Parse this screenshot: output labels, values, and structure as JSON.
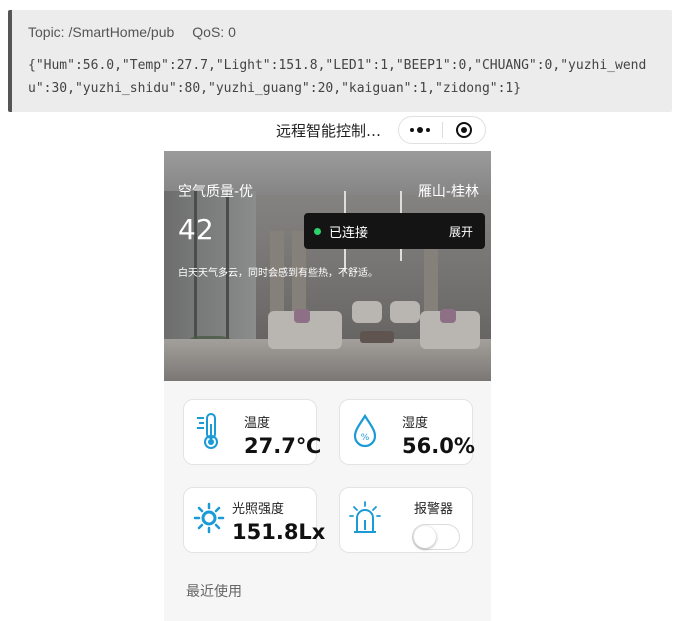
{
  "mqtt": {
    "topic": "Topic: /SmartHome/pub",
    "qos": "QoS: 0",
    "payload": "{\"Hum\":56.0,\"Temp\":27.7,\"Light\":151.8,\"LED1\":1,\"BEEP1\":0,\"CHUANG\":0,\"yuzhi_wendu\":30,\"yuzhi_shidu\":80,\"yuzhi_guang\":20,\"kaiguan\":1,\"zidong\":1}"
  },
  "miniprogram": {
    "title": "远程智能控制…",
    "menu_icon": "more-dots-icon",
    "close_icon": "target-circle-icon"
  },
  "hero": {
    "air_quality": "空气质量-优",
    "location": "雁山-桂林",
    "aqi": "42",
    "weather_desc": "白天天气多云，同时会感到有些热，不舒适。",
    "connection_status": "已连接",
    "expand_label": "展开",
    "status_color": "#2fd16a"
  },
  "sensors": {
    "temperature": {
      "label": "温度",
      "value": "27.7℃",
      "icon": "thermometer-icon"
    },
    "humidity": {
      "label": "湿度",
      "value": "56.0%",
      "icon": "water-drop-icon"
    },
    "light": {
      "label": "光照强度",
      "value": "151.8Lx",
      "icon": "sun-icon"
    },
    "alarm": {
      "label": "报警器",
      "icon": "alarm-light-icon",
      "switch_on": false
    }
  },
  "recent": {
    "label": "最近使用"
  },
  "accent_color": "#1a9ad6"
}
